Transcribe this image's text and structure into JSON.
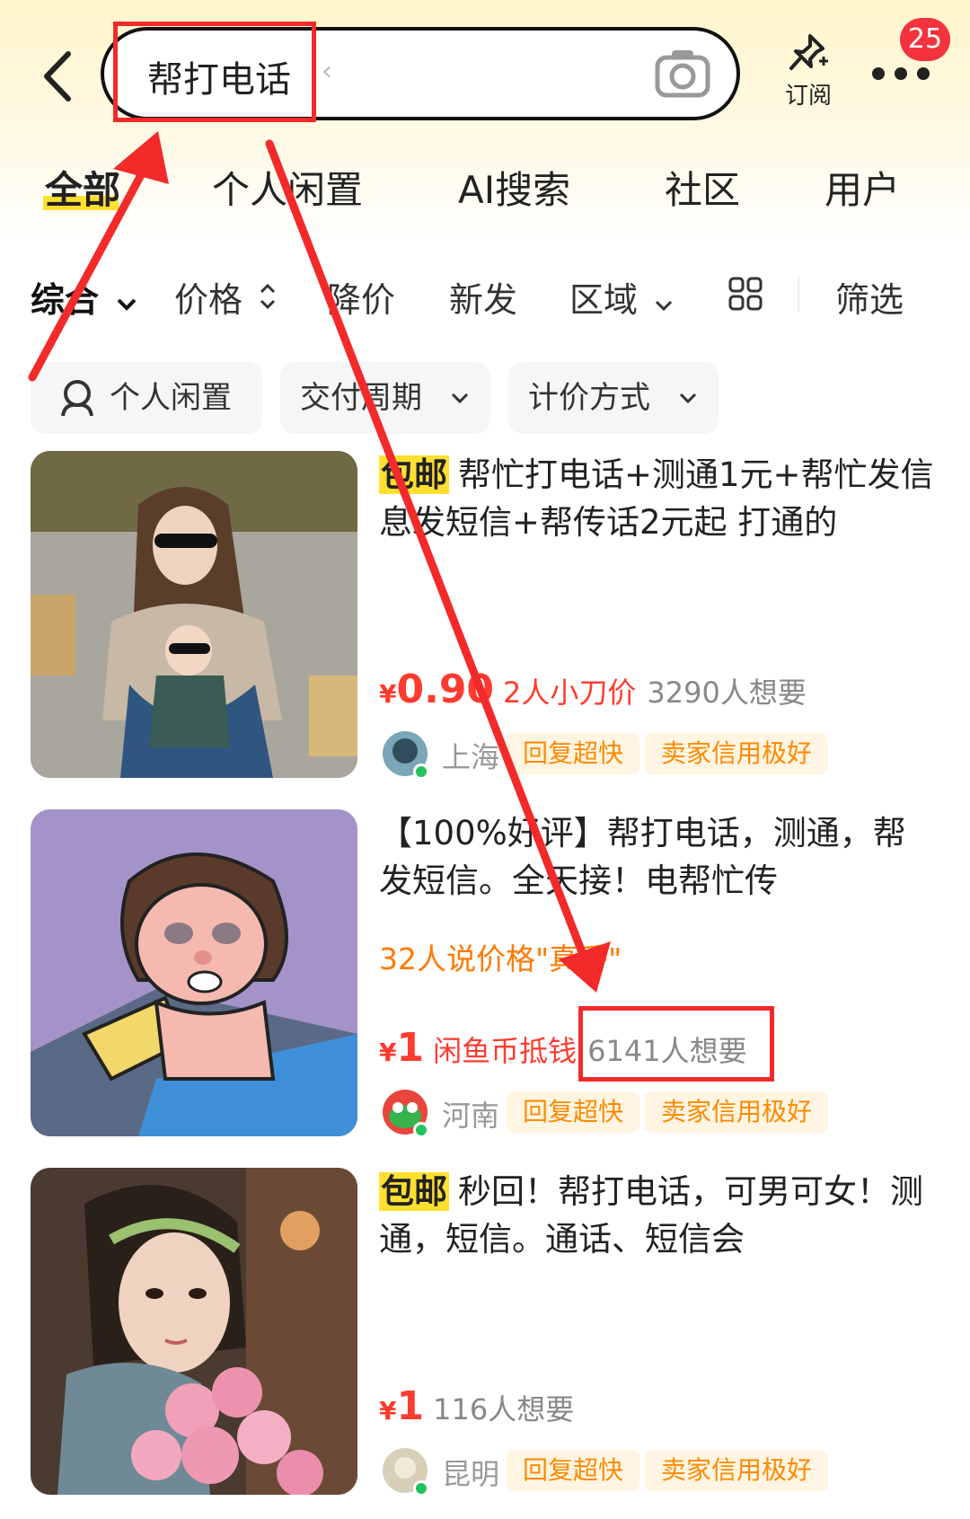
{
  "header": {
    "search_query": "帮打电话",
    "search_clear": "‹",
    "subscribe_label": "订阅",
    "notification_count": "25",
    "icons": [
      "back-arrow-icon",
      "camera-icon",
      "pin-icon",
      "more-icon"
    ]
  },
  "tabs": [
    {
      "label": "全部",
      "active": true
    },
    {
      "label": "个人闲置"
    },
    {
      "label": "AI搜索"
    },
    {
      "label": "社区"
    },
    {
      "label": "用户"
    }
  ],
  "sort": {
    "comprehensive": "综合",
    "price": "价格",
    "price_drop": "降价",
    "new": "新发",
    "region": "区域",
    "filter": "筛选"
  },
  "chips": {
    "personal": "个人闲置",
    "delivery": "交付周期",
    "pricing": "计价方式"
  },
  "items": [
    {
      "badge": "包邮",
      "title": "帮忙打电话+测通1元+帮忙发信息发短信+帮传话2元起 打通的",
      "currency": "¥",
      "price": "0.90",
      "extra": "2人小刀价",
      "want": "3290人想要",
      "location": "上海",
      "tags": [
        "回复超快",
        "卖家信用极好"
      ]
    },
    {
      "badge": "",
      "title": "【100%好评】帮打电话，测通，帮发短信。全天接！电帮忙传",
      "hot": "32人说价格\"真香\"",
      "currency": "¥",
      "price": "1",
      "extra": "闲鱼币抵钱",
      "want": "6141人想要",
      "location": "河南",
      "tags": [
        "回复超快",
        "卖家信用极好"
      ]
    },
    {
      "badge": "包邮",
      "title": "秒回！帮打电话，可男可女！测通，短信。通话、短信会",
      "currency": "¥",
      "price": "1",
      "extra": "",
      "want": "116人想要",
      "location": "昆明",
      "tags": [
        "回复超快",
        "卖家信用极好"
      ]
    }
  ],
  "colors": {
    "accent_yellow": "#ffe031",
    "price_red": "#ff3b2f",
    "tag_orange": "#ff8a00",
    "annotation_red": "#f22a2a"
  }
}
